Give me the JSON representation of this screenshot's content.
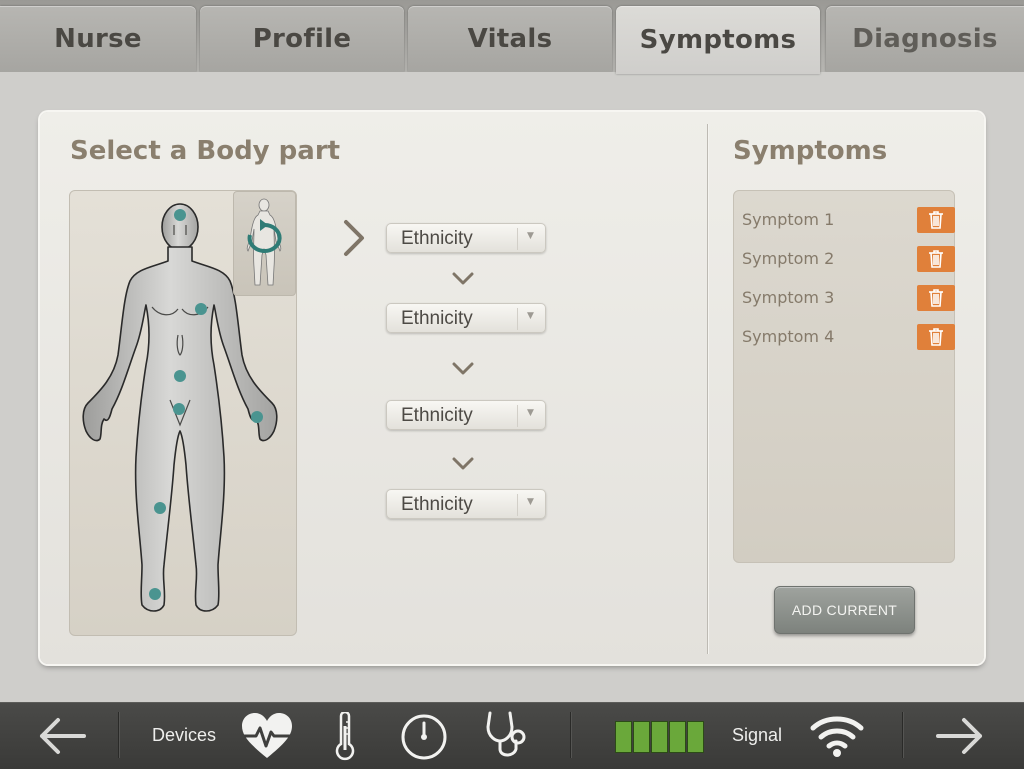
{
  "tabs": [
    {
      "label": "Nurse"
    },
    {
      "label": "Profile"
    },
    {
      "label": "Vitals"
    },
    {
      "label": "Symptoms",
      "active": true
    },
    {
      "label": "Diagnosis"
    }
  ],
  "body_panel": {
    "heading": "Select a Body part",
    "selects": [
      {
        "value": "Ethnicity"
      },
      {
        "value": "Ethnicity"
      },
      {
        "value": "Ethnicity"
      },
      {
        "value": "Ethnicity"
      }
    ]
  },
  "symptoms_panel": {
    "heading": "Symptoms",
    "items": [
      {
        "label": "Symptom 1"
      },
      {
        "label": "Symptom 2"
      },
      {
        "label": "Symptom 3"
      },
      {
        "label": "Symptom 4"
      }
    ],
    "add_button": "ADD CURRENT"
  },
  "bottom_bar": {
    "devices_label": "Devices",
    "signal_label": "Signal",
    "battery_level": 1.0,
    "icons": [
      "back-arrow-icon",
      "heart-rate-icon",
      "thermometer-icon",
      "gauge-icon",
      "stethoscope-icon",
      "wifi-icon",
      "forward-arrow-icon"
    ]
  },
  "colors": {
    "accent_orange": "#e0803a",
    "marker_teal": "#4a9490",
    "battery_green": "#6aa83a"
  }
}
